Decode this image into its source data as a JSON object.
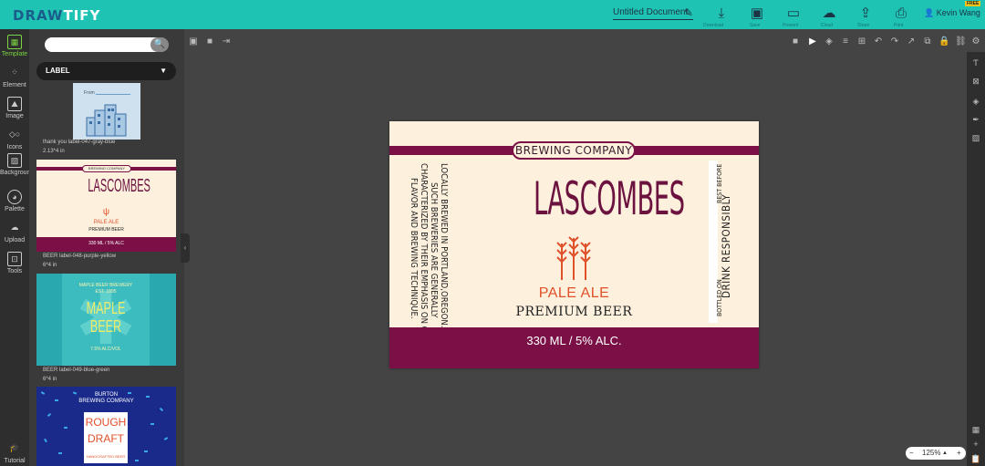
{
  "app": {
    "logo_a": "DRAW",
    "logo_b": "TIFY",
    "doc_title": "Untitled Document",
    "user": "Kevin Wang",
    "free_badge": "FREE"
  },
  "toolbar": {
    "download_label": "Download",
    "save_label": "Save",
    "present_label": "Present",
    "cloud_label": "Cloud",
    "share_label": "Share",
    "print_label": "Print"
  },
  "leftnav": [
    {
      "label": "Template",
      "icon": "template-icon"
    },
    {
      "label": "Element",
      "icon": "element-icon"
    },
    {
      "label": "Image",
      "icon": "image-icon"
    },
    {
      "label": "Icons",
      "icon": "icons-icon"
    },
    {
      "label": "Background",
      "icon": "background-icon"
    },
    {
      "label": "Palette",
      "icon": "palette-icon"
    },
    {
      "label": "Upload",
      "icon": "upload-icon"
    },
    {
      "label": "Tools",
      "icon": "tools-icon"
    },
    {
      "label": "Tutorial",
      "icon": "tutorial-icon"
    }
  ],
  "panel": {
    "search_placeholder": "",
    "category": "LABEL",
    "thumbs": [
      {
        "name": "thank you label-047-gray-blue",
        "size": "2.13*4 in",
        "from_label": "From"
      },
      {
        "name": "BEER label-048-purple-yellow",
        "size": "6*4 in"
      },
      {
        "name": "BEER label-049-blue-green",
        "size": "6*4 in"
      },
      {
        "name": "",
        "size": ""
      }
    ],
    "t2_brewing": "BREWING COMPANY",
    "t2_lascombes": "LASCOMBES",
    "t2_pale": "PALE ALE",
    "t2_premium": "PREMIUM BEER",
    "t2_ml": "330 ML / 5% ALC",
    "t3_brewery": "MAPLE BEER BREWERY",
    "t3_est": "EST. 1895",
    "t3_maple": "MAPLE",
    "t3_beer": "BEER",
    "t3_alc": "7.5% ALC/VOL",
    "t4_burton": "BURTON",
    "t4_brewing": "BREWING COMPANY",
    "t4_rough": "ROUGH",
    "t4_draft": "DRAFT",
    "t4_hand": "HANDCRAFTED BEER"
  },
  "zoom": "125%",
  "label": {
    "brewing": "BREWING COMPANY",
    "title": "LASCOMBES",
    "pale": "PALE ALE",
    "premium": "PREMIUM BEER",
    "volume": "330 ML / 5% ALC.",
    "story_1": "LOCALLY BREWED IN PORTLAND,OREGON.",
    "story_2": "SUCH BREWERIES ARE GENERALLY",
    "story_3": "CHARACTERIZED BY THEIR EMPHASIS ON QUALITY,",
    "story_4": "FLAVOR AND BREWING TECHNIQUE.",
    "best_before": "BEST BEFORE",
    "bottled_on": "BOTTLED ON",
    "drink": "DRINK   RESPONSIBLY"
  },
  "colors": {
    "topbar": "#1fc3b4",
    "wine": "#7b1046",
    "cream": "#fdf1de",
    "orange": "#e0502a"
  }
}
